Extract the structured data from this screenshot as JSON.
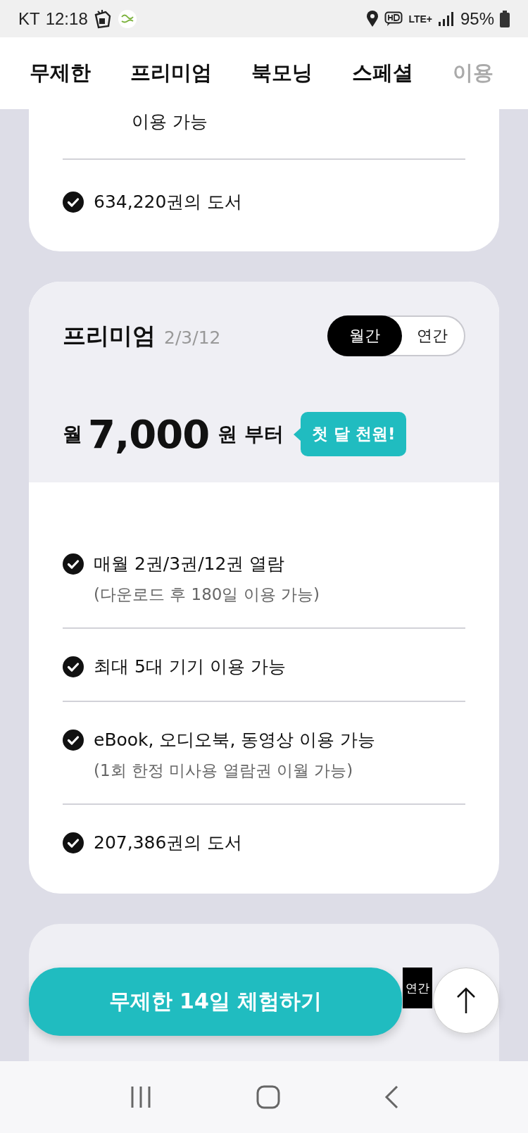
{
  "status_bar": {
    "carrier": "KT",
    "time": "12:18",
    "network": "LTE+",
    "battery": "95%"
  },
  "tabs": [
    {
      "label": "무제한"
    },
    {
      "label": "프리미엄"
    },
    {
      "label": "북모닝"
    },
    {
      "label": "스페셜"
    },
    {
      "label": "이용"
    }
  ],
  "unlimited_card": {
    "features": [
      {
        "kind": "tail",
        "text": "이용 가능"
      },
      {
        "kind": "check",
        "text": "634,220권의 도서"
      }
    ]
  },
  "premium_card": {
    "title": "프리미엄",
    "subtitle": "2/3/12",
    "billing": [
      {
        "label": "월간",
        "selected": true
      },
      {
        "label": "연간",
        "selected": false
      }
    ],
    "price": {
      "prefix": "월",
      "amount": "7,000",
      "suffix": "원 부터"
    },
    "badge": "첫 달 천원!",
    "features": [
      {
        "kind": "check",
        "text": "매월 2권/3권/12권 열람",
        "note": "(다운로드 후 180일 이용 가능)"
      },
      {
        "kind": "check",
        "text": "최대 5대 기기 이용 가능"
      },
      {
        "kind": "check",
        "text": "eBook, 오디오북, 동영상 이용 가능",
        "note": "(1회 한정 미사용 열람권 이월 가능)"
      },
      {
        "kind": "check",
        "text": "207,386권의 도서"
      }
    ]
  },
  "next_card": {
    "billing_fragment": "연간"
  },
  "cta_button": "무제한 14일 체험하기"
}
